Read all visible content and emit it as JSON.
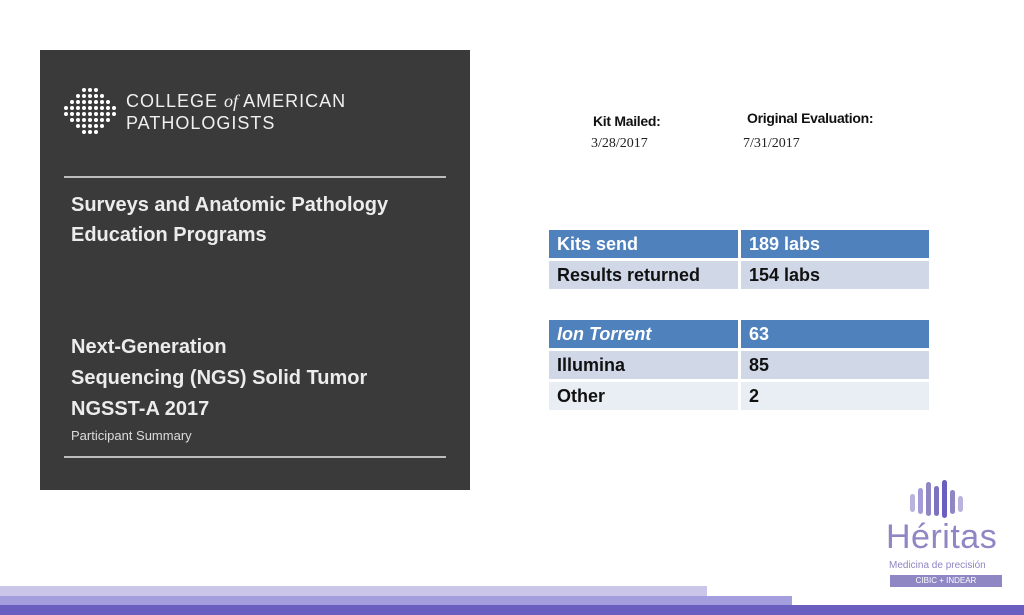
{
  "cover": {
    "org_line1_pre": "COLLEGE ",
    "org_of": "of",
    "org_line1_post": " AMERICAN",
    "org_line2": "PATHOLOGISTS",
    "program_title": "Surveys and Anatomic Pathology Education Programs",
    "survey_lines": [
      "Next-Generation",
      "Sequencing (NGS) Solid Tumor",
      "NGSST-A 2017"
    ],
    "summary": "Participant Summary"
  },
  "dates": {
    "kit_mailed_label": "Kit Mailed:",
    "kit_mailed_value": "3/28/2017",
    "original_eval_label": "Original Evaluation:",
    "original_eval_value": "7/31/2017"
  },
  "table_labs": {
    "rows": [
      {
        "label": "Kits send",
        "value": "189 labs"
      },
      {
        "label": "Results returned",
        "value": "154 labs"
      }
    ]
  },
  "table_platforms": {
    "rows": [
      {
        "label": "Ion Torrent",
        "value": "63"
      },
      {
        "label": "Illumina",
        "value": "85"
      },
      {
        "label": "Other",
        "value": "2"
      }
    ]
  },
  "heritas": {
    "name": "Héritas",
    "subtitle": "Medicina de precisión",
    "tag": "CIBIC + INDEAR",
    "color": "#8f86c4"
  },
  "colors": {
    "table_header": "#4f81bd",
    "table_row_dark": "#d0d8e8",
    "table_row_light": "#e9edf4",
    "cover_bg": "#3a3a3a"
  }
}
